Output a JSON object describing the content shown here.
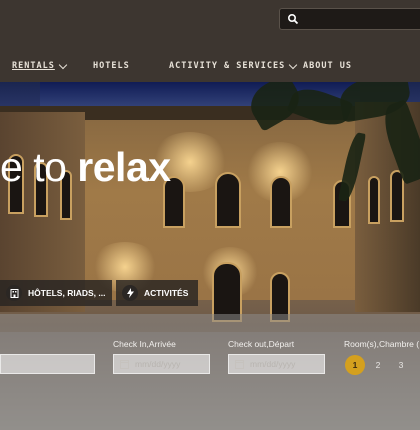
{
  "header": {
    "search": {
      "placeholder": ""
    },
    "nav": [
      {
        "label": "RENTALS",
        "has_dropdown": true,
        "active": true
      },
      {
        "label": "HOTELS",
        "has_dropdown": false
      },
      {
        "label": "ACTIVITY & SERVICES",
        "has_dropdown": true
      },
      {
        "label": "ABOUT US",
        "has_dropdown": false
      }
    ]
  },
  "hero": {
    "slogan_pre": "e to",
    "slogan_bold": "relax"
  },
  "tabs": [
    {
      "label": "HÔTELS, RIADS, ...",
      "icon": "building-icon"
    },
    {
      "label": "ACTIVITÉS",
      "icon": "bolt-icon"
    }
  ],
  "form": {
    "checkin": {
      "label": "Check In,Arrivée",
      "placeholder": "mm/dd/yyyy"
    },
    "checkout": {
      "label": "Check out,Départ",
      "placeholder": "mm/dd/yyyy"
    },
    "rooms": {
      "label": "Room(s),Chambre (",
      "options": [
        "1",
        "2",
        "3"
      ],
      "selected": "1"
    }
  },
  "colors": {
    "accent": "#d4a01e",
    "header_bg": "#3d3630"
  }
}
